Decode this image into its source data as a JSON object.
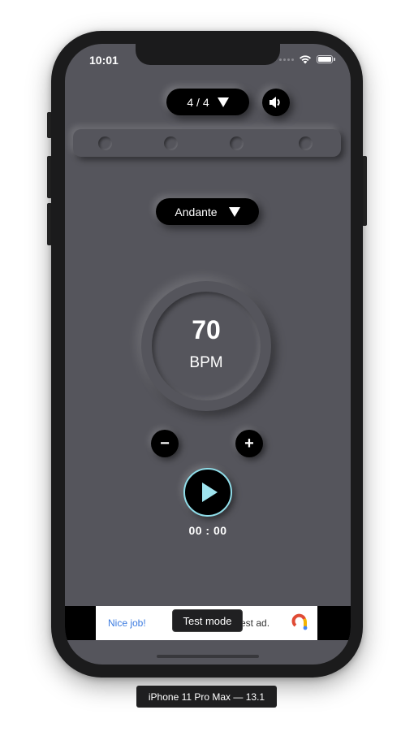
{
  "status_bar": {
    "time": "10:01",
    "icons": [
      "signal-dots-icon",
      "wifi-icon",
      "battery-icon"
    ]
  },
  "controls": {
    "time_signature": "4 / 4",
    "time_signature_icon": "caret-down-icon",
    "sound_icon": "speaker-icon",
    "beats_count": 4,
    "tempo_name": "Andante",
    "tempo_icon": "caret-down-icon",
    "bpm_value": "70",
    "bpm_unit": "BPM",
    "minus_label": "−",
    "plus_label": "+",
    "play_icon": "play-icon",
    "timer": "00 : 00"
  },
  "ad": {
    "headline": "Nice job!",
    "body": "est ad.",
    "test_badge": "Test mode",
    "logo_icon": "admob-logo-icon"
  },
  "device_label": "iPhone 11 Pro Max — 13.1",
  "colors": {
    "screen_bg": "#55555c",
    "accent": "#8fdde9",
    "button_bg": "#000000",
    "ad_link": "#3b7be0"
  }
}
